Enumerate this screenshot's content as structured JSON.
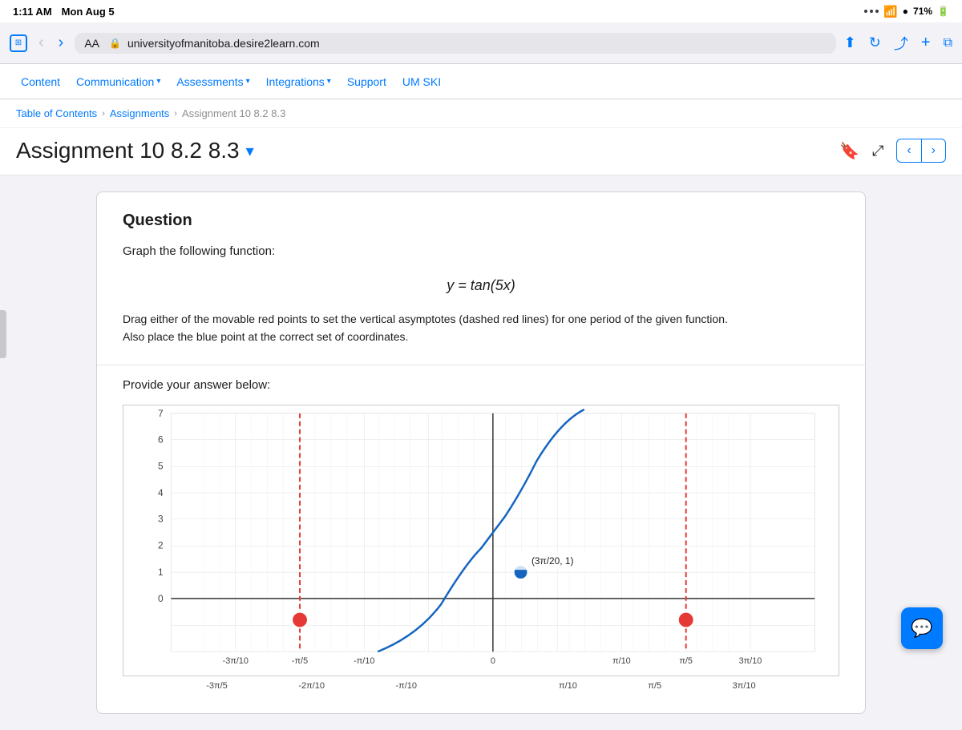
{
  "statusBar": {
    "time": "1:11 AM",
    "day": "Mon Aug 5",
    "wifi": "WiFi",
    "battery": "71%"
  },
  "browserChrome": {
    "aaLabel": "AA",
    "addressUrl": "universityofmanitoba.desire2learn.com"
  },
  "siteNav": {
    "items": [
      {
        "label": "Content",
        "hasDropdown": false
      },
      {
        "label": "Communication",
        "hasDropdown": true
      },
      {
        "label": "Assessments",
        "hasDropdown": true
      },
      {
        "label": "Integrations",
        "hasDropdown": true
      },
      {
        "label": "Support",
        "hasDropdown": false
      },
      {
        "label": "UM SKI",
        "hasDropdown": false
      }
    ]
  },
  "breadcrumb": {
    "items": [
      {
        "label": "Table of Contents",
        "href": "#"
      },
      {
        "label": "Assignments",
        "href": "#"
      },
      {
        "label": "Assignment 10 8.2 8.3",
        "href": "#"
      }
    ]
  },
  "pageHeader": {
    "title": "Assignment 10 8.2 8.3",
    "chevronLabel": "▾"
  },
  "question": {
    "sectionTitle": "Question",
    "descriptionText": "Graph the following function:",
    "formula": "y = tan(5x)",
    "instructions": "Drag either of the movable red points to set the vertical asymptotes (dashed red lines) for one period of the given function.\nAlso place the blue point at the correct set of coordinates.",
    "answerPrompt": "Provide your answer below:"
  },
  "graph": {
    "yMax": 7,
    "yMin": -2,
    "xLabels": [
      "-π/5",
      "-3π/10",
      "-π/5",
      "-π/10",
      "0",
      "π/10",
      "π/5",
      "3π/10",
      "π/5"
    ],
    "pointLabel": "(3π/20, 1)"
  },
  "chatButton": {
    "icon": "💬"
  }
}
